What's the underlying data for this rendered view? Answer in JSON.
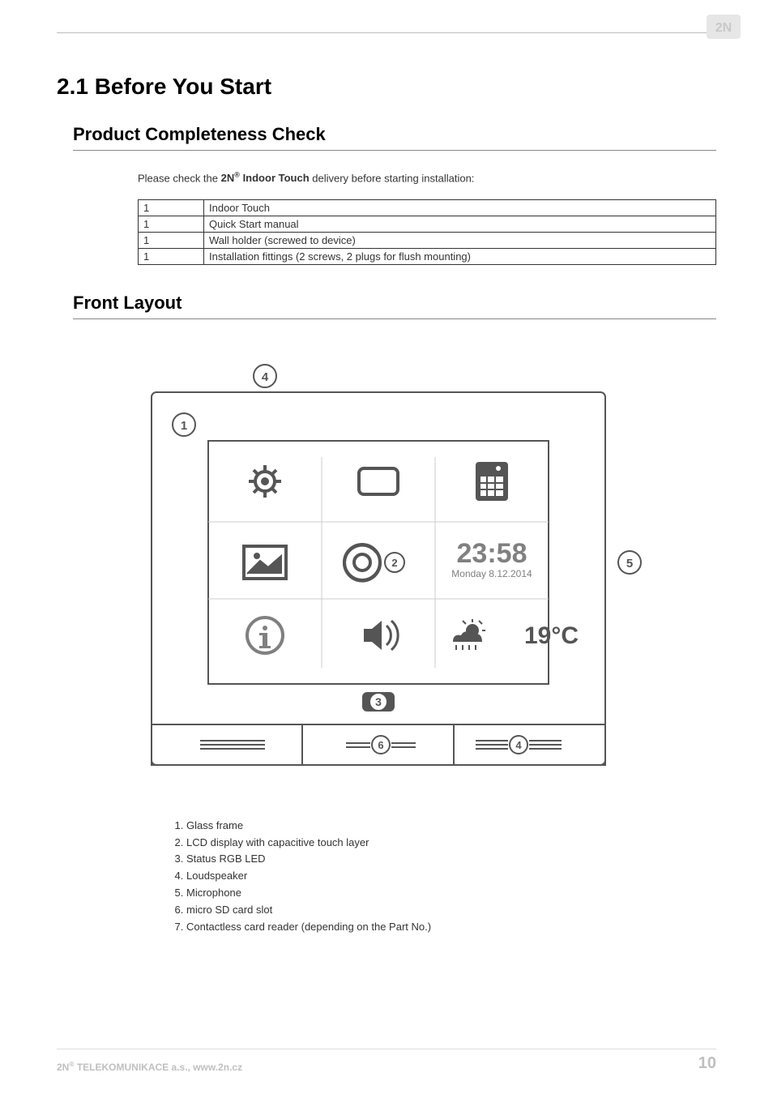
{
  "h1": "2.1 Before You Start",
  "section1": {
    "heading": "Product Completeness Check",
    "intro_pre": "Please check the ",
    "intro_bold_pre": "2N",
    "intro_bold_sup": "®",
    "intro_bold_post": " Indoor Touch",
    "intro_post": " delivery before starting installation:",
    "rows": [
      {
        "qty": "1",
        "item": "Indoor Touch"
      },
      {
        "qty": "1",
        "item": "Quick Start manual"
      },
      {
        "qty": "1",
        "item": "Wall holder (screwed to device)"
      },
      {
        "qty": "1",
        "item": "Installation fittings (2 screws, 2 plugs for flush mounting)"
      }
    ]
  },
  "section2": {
    "heading": "Front Layout",
    "diagram": {
      "clock_time": "23:58",
      "clock_date": "Monday 8.12.2014",
      "temperature": "19°C",
      "callouts": {
        "c1": "1",
        "c2": "2",
        "c3": "3",
        "c4": "4",
        "c5": "5",
        "c6": "6",
        "c_speaker": "4"
      }
    },
    "legend": [
      "Glass frame",
      "LCD display with capacitive touch layer",
      "Status RGB LED",
      "Loudspeaker",
      "Microphone",
      "micro SD card slot",
      "Contactless card reader (depending on the Part No.)"
    ]
  },
  "footer": {
    "left_pre": "2N",
    "left_sup": "®",
    "left_post": " TELEKOMUNIKACE a.s., www.2n.cz",
    "page": "10"
  }
}
